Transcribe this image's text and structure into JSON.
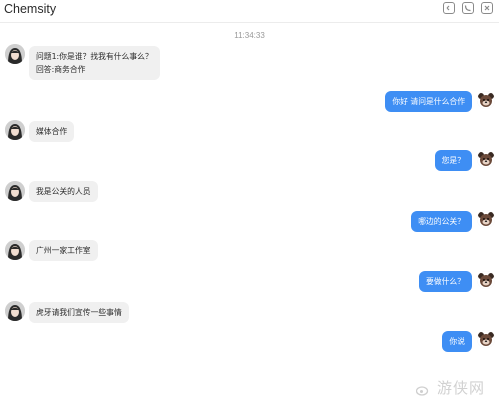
{
  "window": {
    "title": "Chemsity"
  },
  "header_icons": [
    "minimize-icon",
    "phone-icon",
    "close-icon"
  ],
  "timestamp": "11:34:33",
  "colors": {
    "right_bubble": "#3e8ef4",
    "left_bubble": "#f0f0f0"
  },
  "messages": [
    {
      "side": "left",
      "lines": [
        "问题1:你是谁？找我有什么事么？",
        "回答:商务合作"
      ]
    },
    {
      "side": "right",
      "text": "你好 请问是什么合作"
    },
    {
      "side": "left",
      "text": "媒体合作"
    },
    {
      "side": "right",
      "text": "您是？"
    },
    {
      "side": "left",
      "text": "我是公关的人员"
    },
    {
      "side": "right",
      "text": "哪边的公关？"
    },
    {
      "side": "left",
      "text": "广州一家工作室"
    },
    {
      "side": "right",
      "text": "要做什么？"
    },
    {
      "side": "left",
      "text": "虎牙请我们宣传一些事情"
    },
    {
      "side": "right",
      "text": "你说"
    }
  ],
  "watermark": {
    "text": "游侠网"
  }
}
